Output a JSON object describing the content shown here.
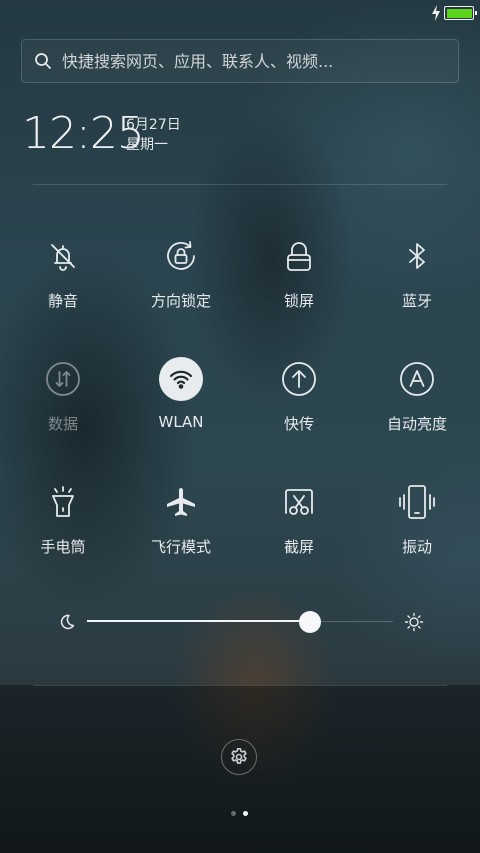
{
  "status_bar": {
    "battery_level": 1.0,
    "charging": true,
    "battery_color": "#5cd41c"
  },
  "search": {
    "placeholder": "快捷搜索网页、应用、联系人、视频...",
    "icon": "search-icon"
  },
  "clock": {
    "time": "12:25",
    "date": "6月27日",
    "weekday": "星期一"
  },
  "toggles": [
    {
      "label": "静音",
      "icon": "bell-off-icon",
      "state": "off"
    },
    {
      "label": "方向锁定",
      "icon": "rotation-lock-icon",
      "state": "off"
    },
    {
      "label": "锁屏",
      "icon": "lock-icon",
      "state": "off"
    },
    {
      "label": "蓝牙",
      "icon": "bluetooth-icon",
      "state": "off"
    },
    {
      "label": "数据",
      "icon": "mobile-data-icon",
      "state": "disabled"
    },
    {
      "label": "WLAN",
      "icon": "wifi-icon",
      "state": "on"
    },
    {
      "label": "快传",
      "icon": "upload-circle-icon",
      "state": "off"
    },
    {
      "label": "自动亮度",
      "icon": "auto-brightness-icon",
      "state": "off"
    },
    {
      "label": "手电筒",
      "icon": "flashlight-icon",
      "state": "off"
    },
    {
      "label": "飞行模式",
      "icon": "airplane-icon",
      "state": "off"
    },
    {
      "label": "截屏",
      "icon": "screenshot-icon",
      "state": "off"
    },
    {
      "label": "振动",
      "icon": "vibrate-icon",
      "state": "off"
    }
  ],
  "brightness": {
    "value": 0.73,
    "min_icon": "moon-icon",
    "max_icon": "sun-icon"
  },
  "settings": {
    "icon": "gear-icon"
  },
  "pager": {
    "pages": 2,
    "current": 2
  },
  "colors": {
    "accent": "#f5f7f8",
    "toggle_on_bg": "#e9ecee",
    "battery": "#5cd41c"
  }
}
